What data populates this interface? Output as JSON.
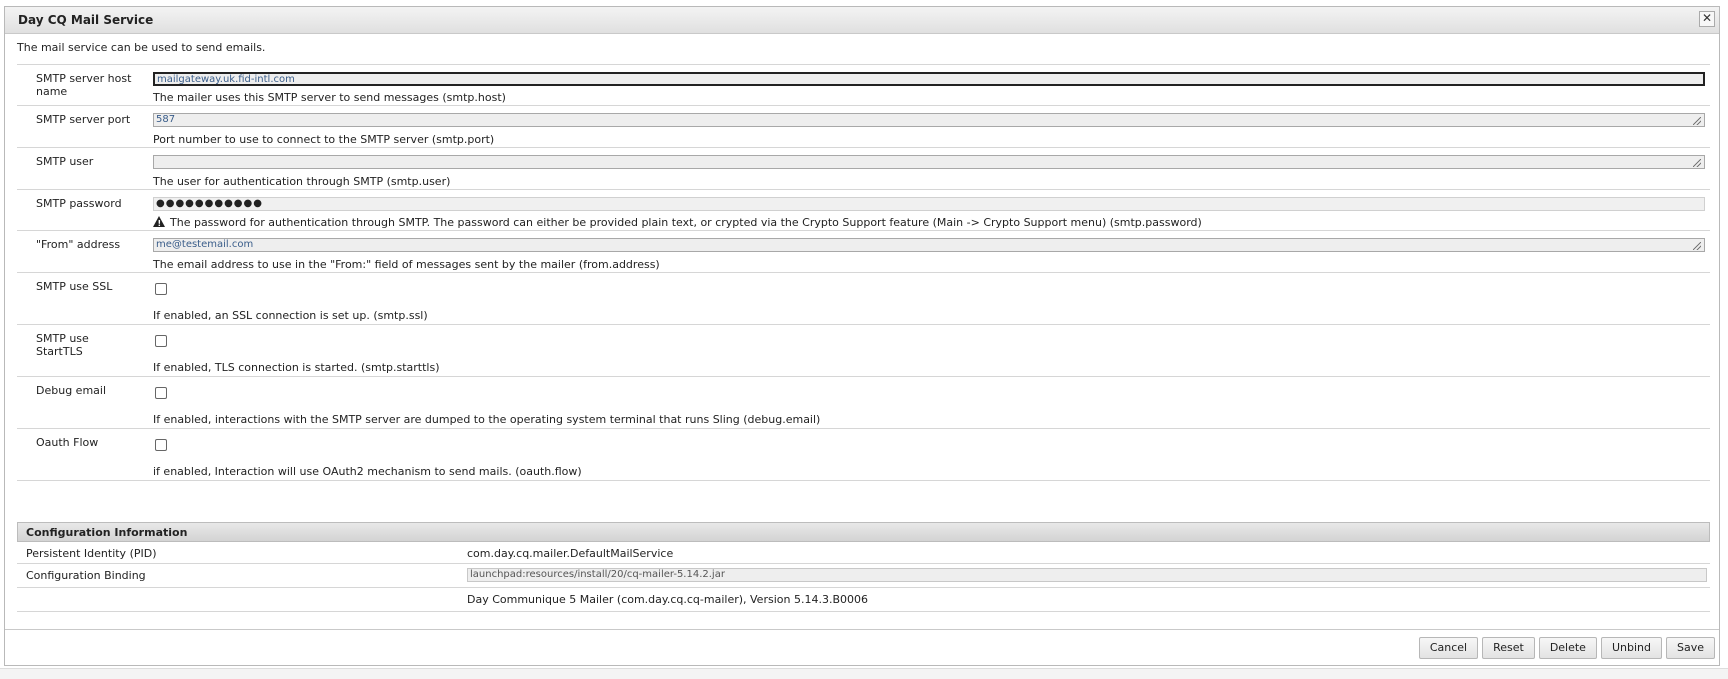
{
  "dialog": {
    "title": "Day CQ Mail Service",
    "close_label": "✕",
    "description": "The mail service can be used to send emails."
  },
  "fields": [
    {
      "label": "SMTP server host name",
      "value": "mailgateway.uk.fid-intl.com",
      "help": "The mailer uses this SMTP server to send messages (smtp.host)"
    },
    {
      "label": "SMTP server port",
      "value": "587",
      "help": "Port number to use to connect to the SMTP server (smtp.port)"
    },
    {
      "label": "SMTP user",
      "value": "",
      "help": "The user for authentication through SMTP (smtp.user)"
    },
    {
      "label": "SMTP password",
      "value": "●●●●●●●●●●●",
      "help": "The password for authentication through SMTP. The password can either be provided plain text, or crypted via the Crypto Support feature (Main -> Crypto Support menu) (smtp.password)"
    },
    {
      "label": "\"From\" address",
      "value": "me@testemail.com",
      "help": "The email address to use in the \"From:\" field of messages sent by the mailer (from.address)"
    },
    {
      "label": "SMTP use SSL",
      "help": "If enabled, an SSL connection is set up. (smtp.ssl)"
    },
    {
      "label": "SMTP use StartTLS",
      "help": "If enabled, TLS connection is started. (smtp.starttls)"
    },
    {
      "label": "Debug email",
      "help": "If enabled, interactions with the SMTP server are dumped to the operating system terminal that runs Sling (debug.email)"
    },
    {
      "label": "Oauth Flow",
      "help": "if enabled, Interaction will use OAuth2 mechanism to send mails. (oauth.flow)"
    }
  ],
  "config_info": {
    "header": "Configuration Information",
    "pid_label": "Persistent Identity (PID)",
    "pid_value": "com.day.cq.mailer.DefaultMailService",
    "binding_label": "Configuration Binding",
    "binding_value": "launchpad:resources/install/20/cq-mailer-5.14.2.jar",
    "bundle_info": "Day Communique 5 Mailer (com.day.cq.cq-mailer), Version 5.14.3.B0006"
  },
  "buttons": {
    "cancel": "Cancel",
    "reset": "Reset",
    "delete": "Delete",
    "unbind": "Unbind",
    "save": "Save"
  }
}
